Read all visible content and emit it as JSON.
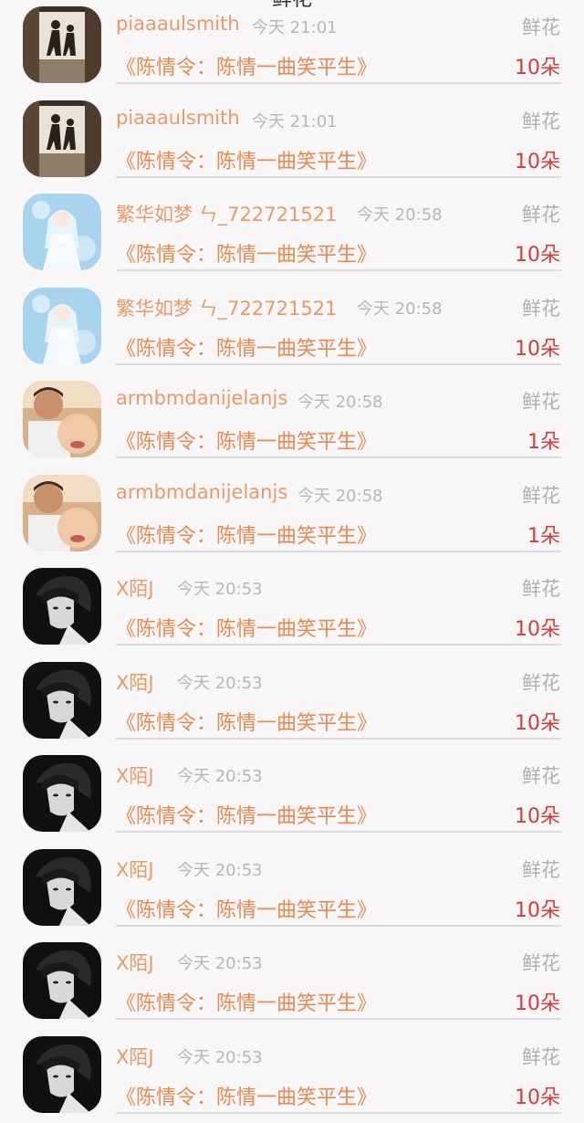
{
  "header": {
    "partial_title": "鲜花"
  },
  "gift_list": [
    {
      "name": "piaaaulsmith",
      "time": "今天 21:01",
      "gift_type": "鲜花",
      "book_title": "《陈情令：陈情一曲笑平生》",
      "count": "10朵",
      "avatar": "silhouette"
    },
    {
      "name": "piaaaulsmith",
      "time": "今天 21:01",
      "gift_type": "鲜花",
      "book_title": "《陈情令：陈情一曲笑平生》",
      "count": "10朵",
      "avatar": "silhouette"
    },
    {
      "name": "繁华如梦 ㄣ_722721521",
      "time": "今天 20:58",
      "gift_type": "鲜花",
      "book_title": "《陈情令：陈情一曲笑平生》",
      "count": "10朵",
      "avatar": "anime-bride"
    },
    {
      "name": "繁华如梦 ㄣ_722721521",
      "time": "今天 20:58",
      "gift_type": "鲜花",
      "book_title": "《陈情令：陈情一曲笑平生》",
      "count": "10朵",
      "avatar": "anime-bride"
    },
    {
      "name": "armbmdanijelanjs",
      "time": "今天 20:58",
      "gift_type": "鲜花",
      "book_title": "《陈情令：陈情一曲笑平生》",
      "count": "1朵",
      "avatar": "selfie"
    },
    {
      "name": "armbmdanijelanjs",
      "time": "今天 20:58",
      "gift_type": "鲜花",
      "book_title": "《陈情令：陈情一曲笑平生》",
      "count": "1朵",
      "avatar": "selfie"
    },
    {
      "name": "X陌J",
      "time": "今天 20:53",
      "gift_type": "鲜花",
      "book_title": "《陈情令：陈情一曲笑平生》",
      "count": "10朵",
      "avatar": "bw-portrait"
    },
    {
      "name": "X陌J",
      "time": "今天 20:53",
      "gift_type": "鲜花",
      "book_title": "《陈情令：陈情一曲笑平生》",
      "count": "10朵",
      "avatar": "bw-portrait"
    },
    {
      "name": "X陌J",
      "time": "今天 20:53",
      "gift_type": "鲜花",
      "book_title": "《陈情令：陈情一曲笑平生》",
      "count": "10朵",
      "avatar": "bw-portrait"
    },
    {
      "name": "X陌J",
      "time": "今天 20:53",
      "gift_type": "鲜花",
      "book_title": "《陈情令：陈情一曲笑平生》",
      "count": "10朵",
      "avatar": "bw-portrait"
    },
    {
      "name": "X陌J",
      "time": "今天 20:53",
      "gift_type": "鲜花",
      "book_title": "《陈情令：陈情一曲笑平生》",
      "count": "10朵",
      "avatar": "bw-portrait"
    },
    {
      "name": "X陌J",
      "time": "今天 20:53",
      "gift_type": "鲜花",
      "book_title": "《陈情令：陈情一曲笑平生》",
      "count": "10朵",
      "avatar": "bw-portrait"
    }
  ],
  "colors": {
    "name": "#e89a67",
    "book_title": "#e8894f",
    "count": "#d43b3b",
    "muted": "#b7b7b7",
    "background": "#f8f6f6"
  }
}
